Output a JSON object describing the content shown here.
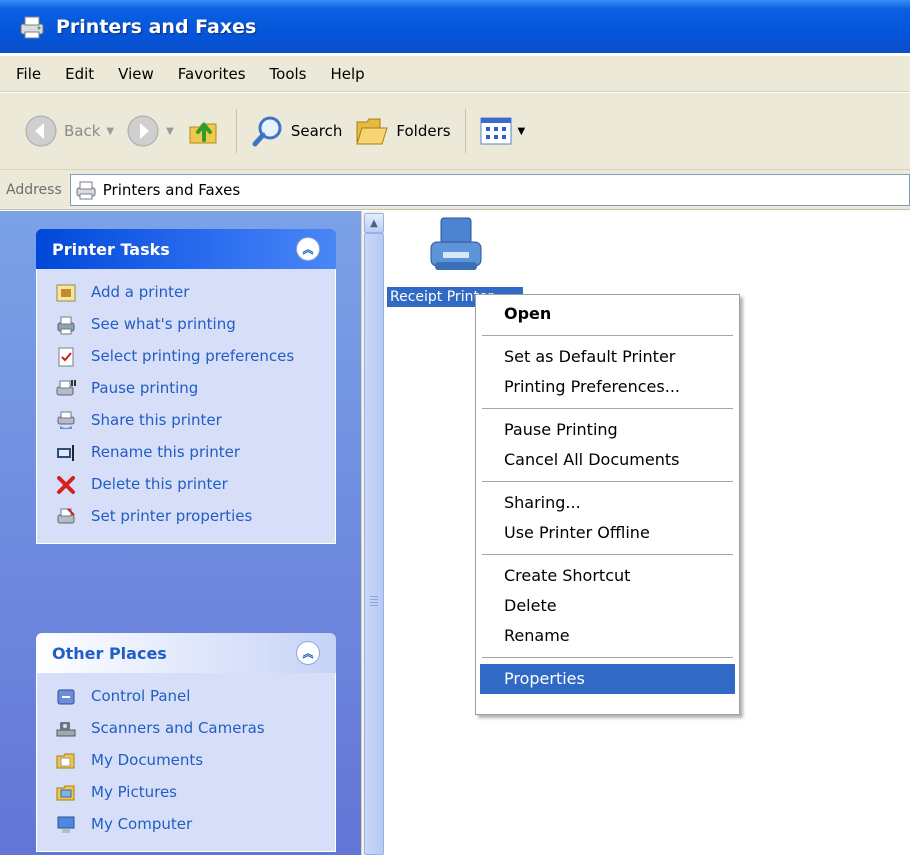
{
  "window": {
    "title": "Printers and Faxes"
  },
  "menubar": {
    "items": [
      "File",
      "Edit",
      "View",
      "Favorites",
      "Tools",
      "Help"
    ]
  },
  "toolbar": {
    "back_label": "Back",
    "search_label": "Search",
    "folders_label": "Folders"
  },
  "address": {
    "label": "Address",
    "value": "Printers and Faxes"
  },
  "printer_tasks": {
    "title": "Printer Tasks",
    "items": [
      {
        "label": "Add a printer",
        "icon": "add-printer-icon"
      },
      {
        "label": "See what's printing",
        "icon": "print-queue-icon"
      },
      {
        "label": "Select printing preferences",
        "icon": "preferences-icon"
      },
      {
        "label": "Pause printing",
        "icon": "pause-printer-icon"
      },
      {
        "label": "Share this printer",
        "icon": "share-printer-icon"
      },
      {
        "label": "Rename this printer",
        "icon": "rename-icon"
      },
      {
        "label": "Delete this printer",
        "icon": "delete-icon"
      },
      {
        "label": "Set printer properties",
        "icon": "printer-properties-icon"
      }
    ]
  },
  "other_places": {
    "title": "Other Places",
    "items": [
      {
        "label": "Control Panel",
        "icon": "control-panel-icon"
      },
      {
        "label": "Scanners and Cameras",
        "icon": "scanner-camera-icon"
      },
      {
        "label": "My Documents",
        "icon": "documents-folder-icon"
      },
      {
        "label": "My Pictures",
        "icon": "pictures-folder-icon"
      },
      {
        "label": "My Computer",
        "icon": "computer-icon"
      }
    ]
  },
  "content": {
    "printer_name": "Receipt Printer"
  },
  "context_menu": {
    "open": "Open",
    "set_default": "Set as Default Printer",
    "printing_prefs": "Printing Preferences...",
    "pause": "Pause Printing",
    "cancel_all": "Cancel All Documents",
    "sharing": "Sharing...",
    "offline": "Use Printer Offline",
    "create_shortcut": "Create Shortcut",
    "delete": "Delete",
    "rename": "Rename",
    "properties": "Properties"
  },
  "colors": {
    "title_bar": "#0554d8",
    "chrome": "#ece9d8",
    "task_pane": "#6f8fe0",
    "task_link": "#215dc6",
    "selection": "#316ac5"
  }
}
